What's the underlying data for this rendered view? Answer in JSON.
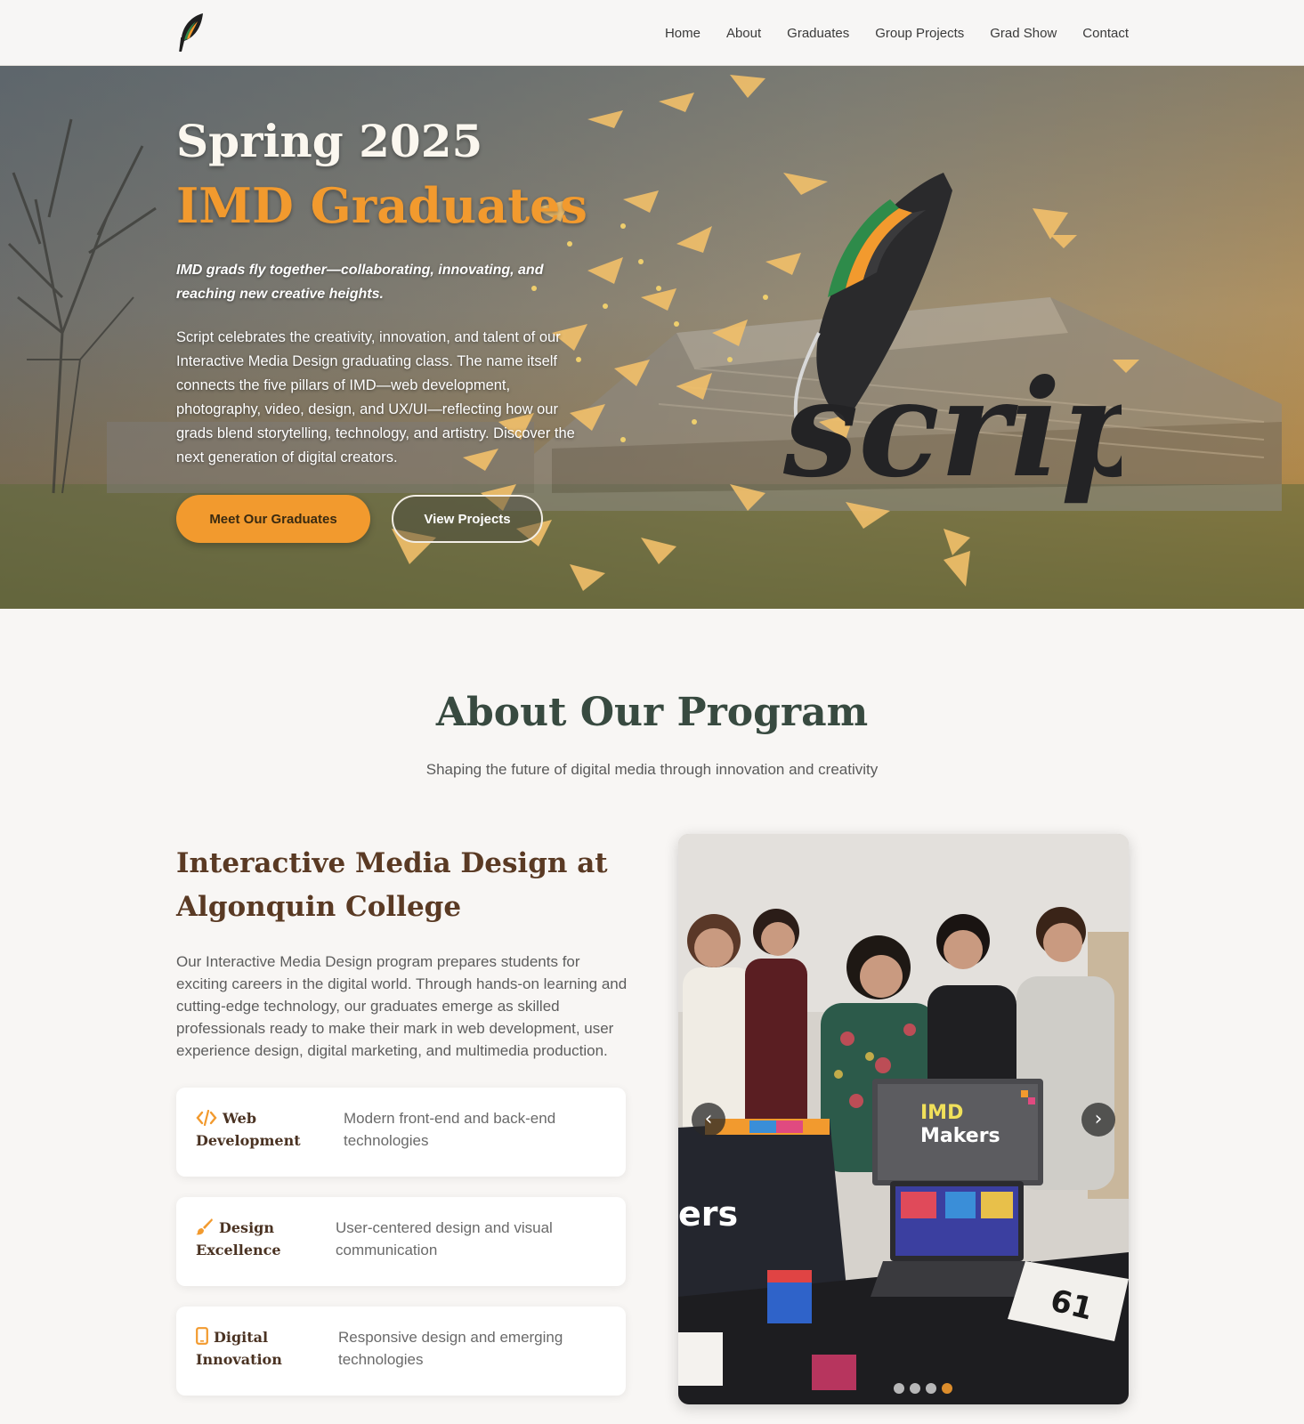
{
  "nav": {
    "logo_name": "quill-logo",
    "links": [
      "Home",
      "About",
      "Graduates",
      "Group Projects",
      "Grad Show",
      "Contact"
    ]
  },
  "hero": {
    "title_line1": "Spring 2025",
    "title_line2": "IMD Graduates",
    "tagline": "IMD grads fly together—collaborating, innovating, and reaching new creative heights.",
    "body": "Script celebrates the creativity, innovation, and talent of our Interactive Media Design graduating class. The name itself connects the five pillars of IMD—web development, photography, video, design, and UX/UI—reflecting how our grads blend storytelling, technology, and artistry. Discover the next generation of digital creators.",
    "primary_button": "Meet Our Graduates",
    "secondary_button": "View Projects",
    "brand_word": "script"
  },
  "about": {
    "heading": "About Our Program",
    "subheading": "Shaping the future of digital media through innovation and creativity",
    "program_title": "Interactive Media Design at Algonquin College",
    "program_body": "Our Interactive Media Design program prepares students for exciting careers in the digital world. Through hands-on learning and cutting-edge technology, our graduates emerge as skilled professionals ready to make their mark in web development, user experience design, digital marketing, and multimedia production.",
    "features": [
      {
        "icon": "code-icon",
        "title": "Web Development",
        "description": "Modern front-end and back-end technologies"
      },
      {
        "icon": "paintbrush-icon",
        "title": "Design Excellence",
        "description": "User-centered design and visual communication"
      },
      {
        "icon": "mobile-icon",
        "title": "Digital Innovation",
        "description": "Responsive design and emerging technologies"
      }
    ]
  },
  "carousel": {
    "prev_label": "‹",
    "next_label": "›",
    "slide_count": 4,
    "active_slide": 4,
    "photo_text": {
      "monitor_brand_1": "IMD",
      "monitor_brand_2": "Makers",
      "table_card_number": "61",
      "poster_fragment": "ers"
    }
  },
  "colors": {
    "accent": "#f29a2e",
    "heading_green": "#384a40",
    "heading_brown": "#5a3a24",
    "page_bg": "#f8f6f4"
  }
}
